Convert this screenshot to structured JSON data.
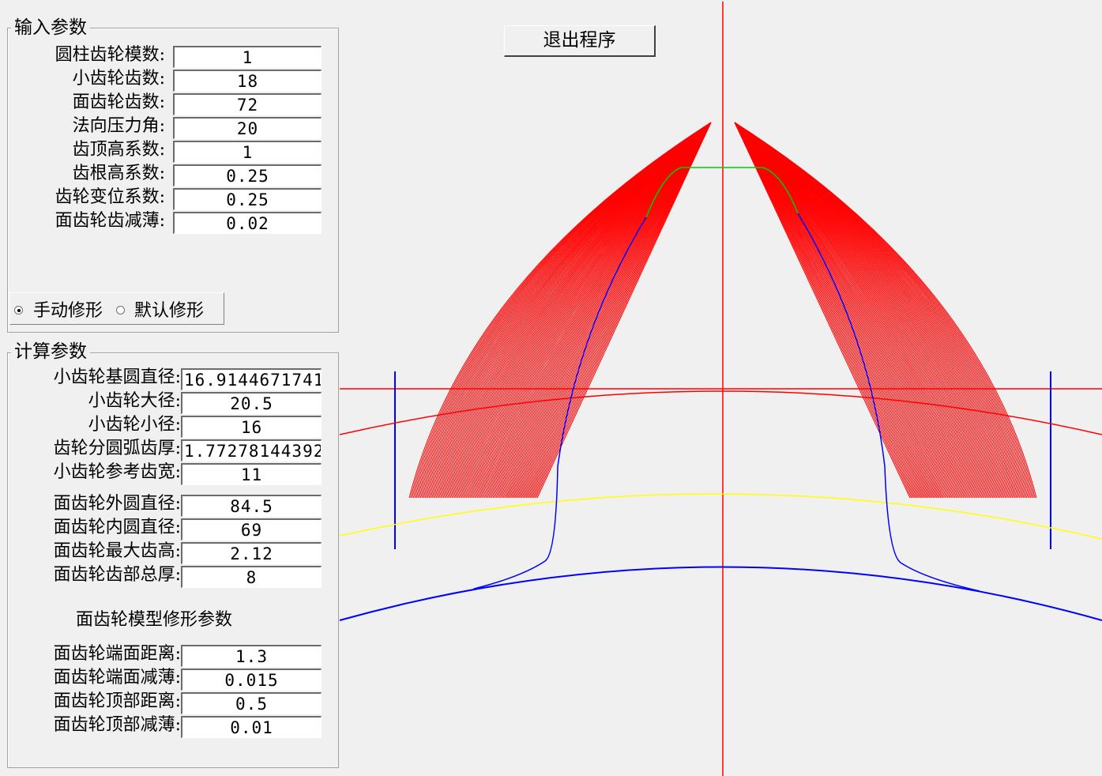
{
  "exit_button": "退出程序",
  "input_group": {
    "title": "输入参数",
    "fields": [
      {
        "label": "圆柱齿轮模数:",
        "value": "1"
      },
      {
        "label": "小齿轮齿数:",
        "value": "18"
      },
      {
        "label": "面齿轮齿数:",
        "value": "72"
      },
      {
        "label": "法向压力角:",
        "value": "20"
      },
      {
        "label": "齿顶高系数:",
        "value": "1"
      },
      {
        "label": "齿根高系数:",
        "value": "0.25"
      },
      {
        "label": "齿轮变位系数:",
        "value": "0.25"
      },
      {
        "label": "面齿轮齿减薄:",
        "value": "0.02"
      }
    ],
    "radio_manual": "手动修形",
    "radio_default": "默认修形",
    "selected": "manual"
  },
  "calc_group": {
    "title": "计算参数",
    "fields": [
      {
        "label": "小齿轮基圆直径:",
        "value": "16.9144671741"
      },
      {
        "label": "小齿轮大径:",
        "value": "20.5"
      },
      {
        "label": "小齿轮小径:",
        "value": "16"
      },
      {
        "label": "齿轮分圆弧齿厚:",
        "value": "1.77278144392"
      },
      {
        "label": "小齿轮参考齿宽:",
        "value": "11"
      },
      {
        "label": "面齿轮外圆直径:",
        "value": "84.5"
      },
      {
        "label": "面齿轮内圆直径:",
        "value": "69"
      },
      {
        "label": "面齿轮最大齿高:",
        "value": "2.12"
      },
      {
        "label": "面齿轮齿部总厚:",
        "value": "8"
      }
    ],
    "mod_title": "面齿轮模型修形参数",
    "mod_fields": [
      {
        "label": "面齿轮端面距离:",
        "value": "1.3"
      },
      {
        "label": "面齿轮端面减薄:",
        "value": "0.015"
      },
      {
        "label": "面齿轮顶部距离:",
        "value": "0.5"
      },
      {
        "label": "面齿轮顶部减薄:",
        "value": "0.01"
      }
    ]
  },
  "colors": {
    "axis": "#ff0000",
    "tooth_fill": "#ff0000",
    "flank": "#0000ff",
    "top_profile": "#00cc00",
    "reference_arc": "#ffff00",
    "root_arc": "#0000ff",
    "limit_lines": "#0000ff"
  }
}
